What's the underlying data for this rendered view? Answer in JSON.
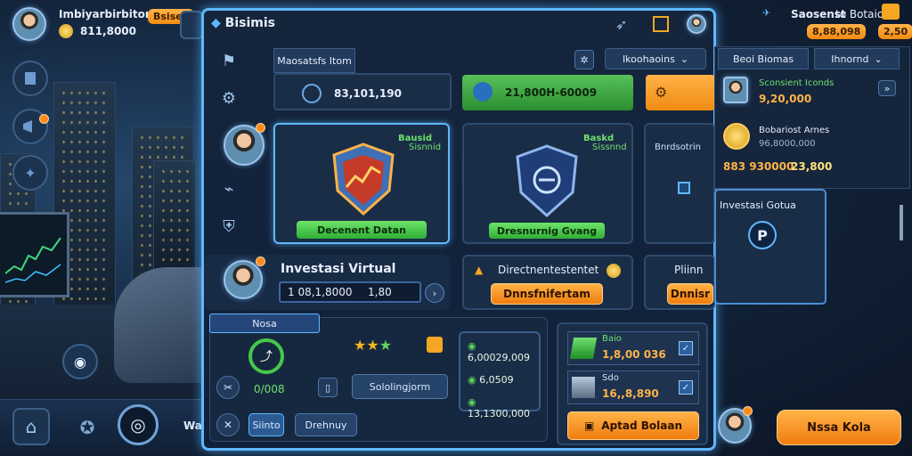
{
  "player_top_left": {
    "name": "Imbiyarbirbiton",
    "tag": "Bsiseo",
    "coins": "811,8000"
  },
  "topbar_right": {
    "title": "Saosenst",
    "sub": "to Botaio",
    "coins": "8,88,098",
    "pill": "2,50"
  },
  "panel": {
    "title": "Bisimis",
    "tab_label": "Maosatsfs Itom",
    "dropdown": "Ikoohaoins",
    "stat1": "83,101,190",
    "stat2": "21,800H-60009",
    "card1": {
      "tag": "Bausid",
      "tag2": "Sisnnid",
      "button": "Decenent Datan"
    },
    "card2": {
      "tag": "Baskd",
      "tag2": "Sissnnd",
      "button": "Dresnurnig Gvang"
    },
    "card3": {
      "label": "Bnrdsotrin"
    },
    "investasi": {
      "title": "Investasi Virtual",
      "value": "1 08,1,8000",
      "suffix": "1,80"
    },
    "mid": {
      "title": "Directnentestentet",
      "button": "Dnnsfnifertam"
    },
    "mid2": {
      "title": "Pliinn",
      "button": "Dnnisr"
    },
    "bottom_tab": "Nosa",
    "bottom_value": "0/008",
    "bottom_btn": "Sololingjorm",
    "bottom_small_btn": "Siinto",
    "bottom_outline_btn": "Drehnuy",
    "stats_list": [
      "6,00029,009",
      "6,0509",
      "13,1300,000"
    ],
    "shop1": {
      "label": "Baio",
      "value": "1,8,00 036"
    },
    "shop2": {
      "label": "Sdo",
      "value": "16,,8,890"
    },
    "shop_button": "Aptad Bolaan"
  },
  "right": {
    "dropdown1": "Beoi Biomas",
    "dropdown2": "Ihnornd",
    "item1_title": "Sconsient Iconds",
    "item1_value": "9,20,000",
    "item2_title": "Bobariost Arnes",
    "item2_sub": "96,8000,000",
    "item2_value_a": "883 930000",
    "item2_value_b": "23,800",
    "card_title": "Investasi Gotua",
    "bottom_button": "Nssa Kola"
  },
  "bottom_left": {
    "label": "Wa"
  },
  "colors": {
    "accent": "#5fb8ff",
    "orange": "#f58a16",
    "green": "#39b83c",
    "bg": "#13253d"
  }
}
